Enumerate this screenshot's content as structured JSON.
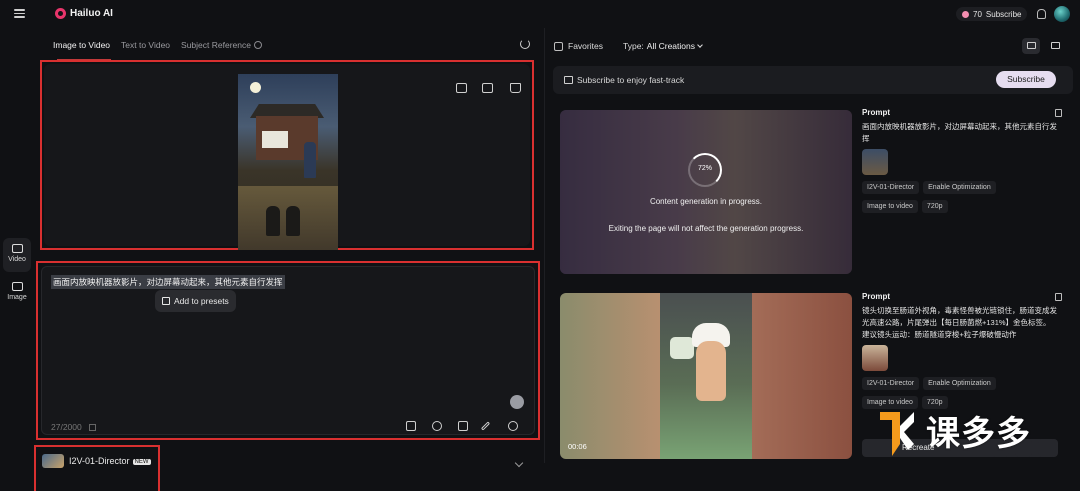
{
  "app": {
    "name": "Hailuo AI"
  },
  "header": {
    "credits": "70",
    "subscribe_label": "Subscribe"
  },
  "rail": {
    "items": [
      {
        "label": "Video"
      },
      {
        "label": "Image"
      }
    ]
  },
  "tabs": [
    {
      "label": "Image to Video"
    },
    {
      "label": "Text to Video"
    },
    {
      "label": "Subject Reference"
    }
  ],
  "prompt": {
    "text": "画面内放映机器放影片，对边屏幕动起来，其他元素自行发挥",
    "presets_label": "Add to presets",
    "char_count": "27/2000"
  },
  "model": {
    "name": "I2V-01-Director",
    "badge": "NEW"
  },
  "history": {
    "favorites_label": "Favorites",
    "type_label": "Type:",
    "type_value": "All Creations",
    "fasttrack_text": "Subscribe to enjoy fast-track",
    "fasttrack_button": "Subscribe"
  },
  "creations": [
    {
      "status": "generating",
      "progress": "72%",
      "message_1": "Content generation in progress.",
      "message_2": "Exiting the page will not affect the generation progress.",
      "prompt_label": "Prompt",
      "prompt_text": "画面内放映机器放影片，对边屏幕动起来，其他元素自行发挥",
      "model": "I2V-01-Director",
      "optimization": "Enable Optimization",
      "mode": "Image to video",
      "resolution": "720p"
    },
    {
      "status": "done",
      "duration": "00:06",
      "prompt_label": "Prompt",
      "prompt_text": "镜头切换至肠道外视角，毒素怪兽被光链锁住，肠道变成发光高速公路，片尾弹出【每日肠菌燃+131%】金色标签。建议镜头运动：肠道隧道穿梭+粒子爆破慢动作",
      "model": "I2V-01-Director",
      "optimization": "Enable Optimization",
      "mode": "Image to video",
      "resolution": "720p",
      "action_label": "Recreate"
    }
  ],
  "watermark": {
    "text": "课多多"
  },
  "colors": {
    "highlight_red": "#d93030",
    "accent_pink": "#e8356b",
    "subscribe_bg": "#e6ddf0"
  }
}
